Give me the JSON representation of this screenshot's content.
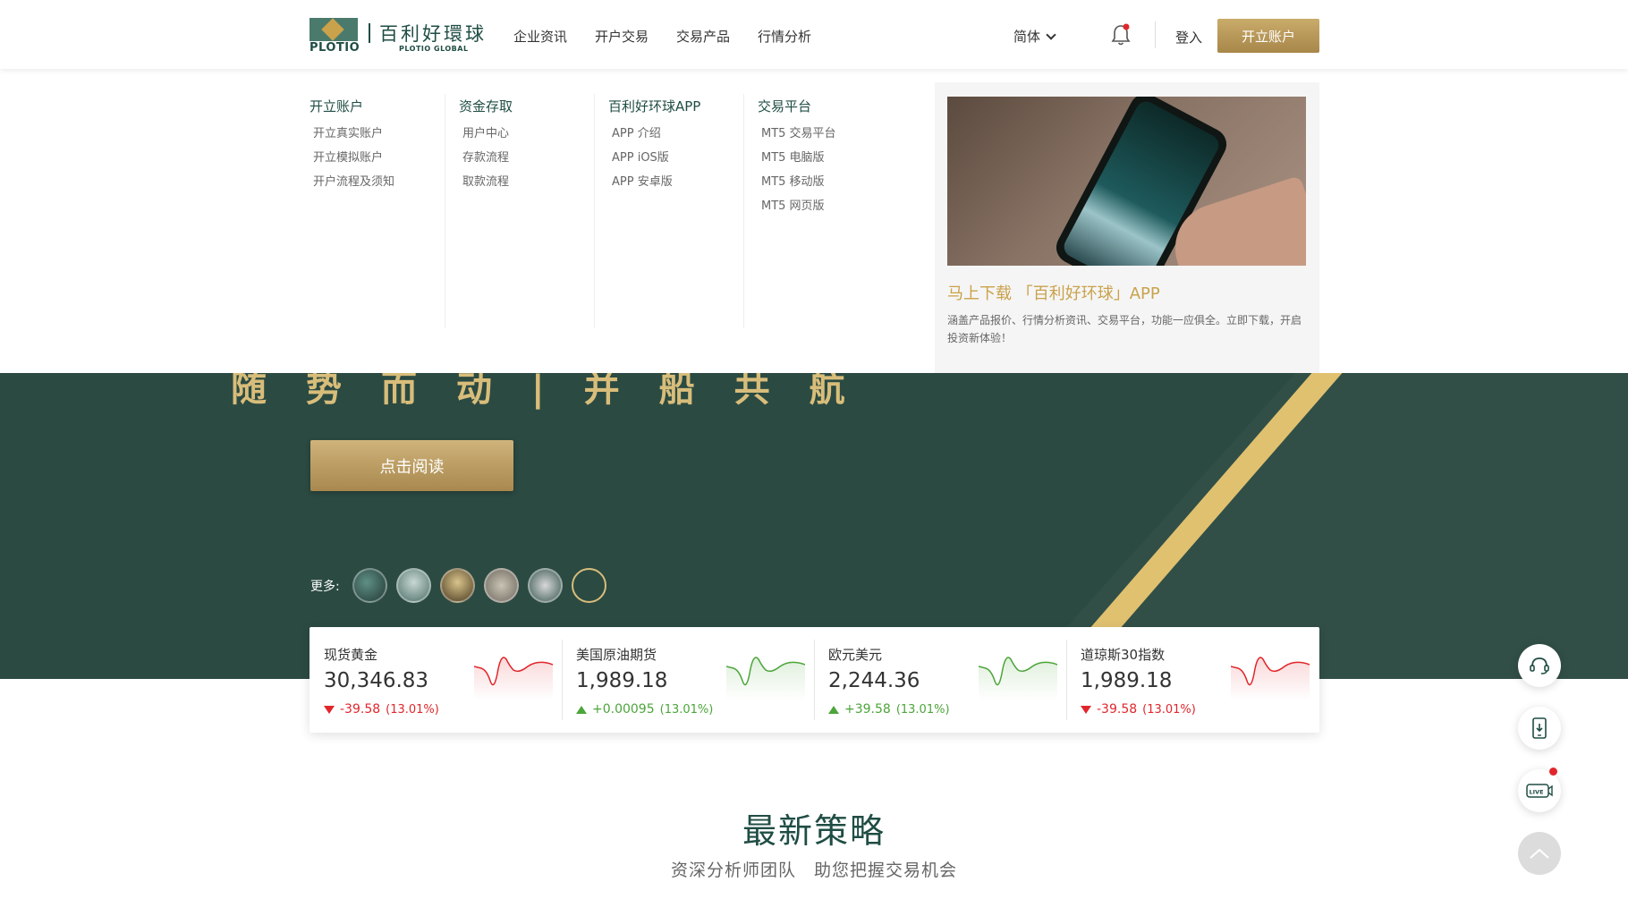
{
  "header": {
    "logo": {
      "mark_text": "PLOTIO",
      "name_cn": "百利好環球",
      "name_en": "PLOTIO GLOBAL"
    },
    "nav": [
      "企业资讯",
      "开户交易",
      "交易产品",
      "行情分析"
    ],
    "language": "简体",
    "login_label": "登入",
    "open_account_label": "开立账户"
  },
  "mega_menu": {
    "columns": [
      {
        "title": "开立账户",
        "items": [
          "开立真实账户",
          "开立模拟账户",
          "开户流程及须知"
        ]
      },
      {
        "title": "资金存取",
        "items": [
          "用户中心",
          "存款流程",
          "取款流程"
        ]
      },
      {
        "title": "百利好环球APP",
        "items": [
          "APP 介绍",
          "APP iOS版",
          "APP 安卓版"
        ]
      },
      {
        "title": "交易平台",
        "items": [
          "MT5 交易平台",
          "MT5 电脑版",
          "MT5 移动版",
          "MT5 网页版"
        ]
      }
    ],
    "promo": {
      "title": "马上下载 「百利好环球」APP",
      "description": "涵盖产品报价、行情分析资讯、交易平台，功能一应俱全。立即下载，开启投资新体验！"
    }
  },
  "hero": {
    "motto": "随势而动|并船共航",
    "read_button": "点击阅读",
    "more_label": "更多:"
  },
  "ticker": [
    {
      "name": "现货黄金",
      "price": "30,346.83",
      "change": "-39.58",
      "percent": "(13.01%)",
      "direction": "down"
    },
    {
      "name": "美国原油期货",
      "price": "1,989.18",
      "change": "+0.00095",
      "percent": "(13.01%)",
      "direction": "up"
    },
    {
      "name": "欧元美元",
      "price": "2,244.36",
      "change": "+39.58",
      "percent": "(13.01%)",
      "direction": "up"
    },
    {
      "name": "道琼斯30指数",
      "price": "1,989.18",
      "change": "-39.58",
      "percent": "(13.01%)",
      "direction": "down"
    }
  ],
  "strategy": {
    "title": "最新策略",
    "subtitle": "资深分析师团队　助您把握交易机会"
  },
  "colors": {
    "brand_green": "#1f4d44",
    "hero_green": "#2b4a42",
    "gold": "#c9a24b",
    "down_red": "#e0262b",
    "up_green": "#4ca53a"
  },
  "icons": [
    "bell-icon",
    "chevron-down-icon",
    "headset-icon",
    "phone-download-icon",
    "live-icon",
    "back-to-top-icon"
  ]
}
